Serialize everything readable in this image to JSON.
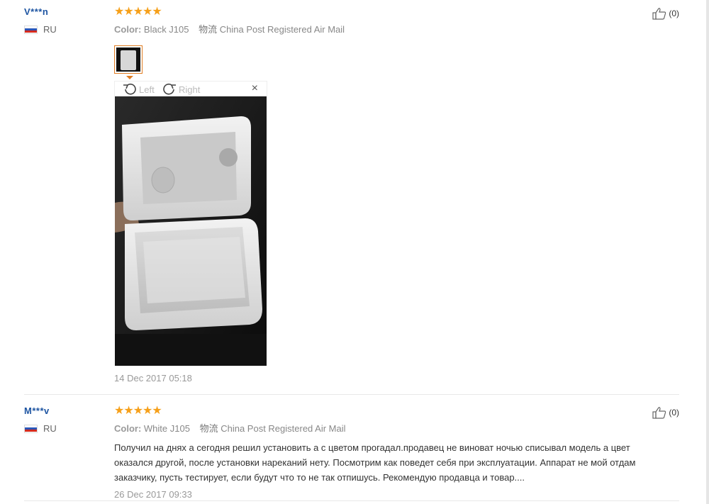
{
  "reviews": [
    {
      "user": "V***n",
      "country": "RU",
      "stars": "★★★★★",
      "rating": 5,
      "color_label": "Color:",
      "color_value": "Black J105",
      "shipping_label": "物流",
      "shipping_value": "China Post Registered Air Mail",
      "likes": "(0)",
      "viewer": {
        "left_label": "Left",
        "right_label": "Right",
        "close": "×"
      },
      "date": "14 Dec 2017 05:18"
    },
    {
      "user": "M***v",
      "country": "RU",
      "stars": "★★★★★",
      "rating": 5,
      "color_label": "Color:",
      "color_value": "White J105",
      "shipping_label": "物流",
      "shipping_value": "China Post Registered Air Mail",
      "likes": "(0)",
      "text_lines": [
        "Получил на днях а сегодня решил установить а с цветом прогадал.продавец не виноват ночью списывал модель а цвет",
        "оказался другой, после установки нареканий нету. Посмотрим как поведет себя при эксплуатации. Аппарат не мой отдам",
        "заказчику, пусть тестирует, если будут что то не так отпишусь. Рекомендую продавца и товар...."
      ],
      "date": "26 Dec 2017 09:33"
    }
  ],
  "colors": {
    "star": "#f6a01a",
    "username": "#1e55a2",
    "accent": "#e07c22"
  }
}
